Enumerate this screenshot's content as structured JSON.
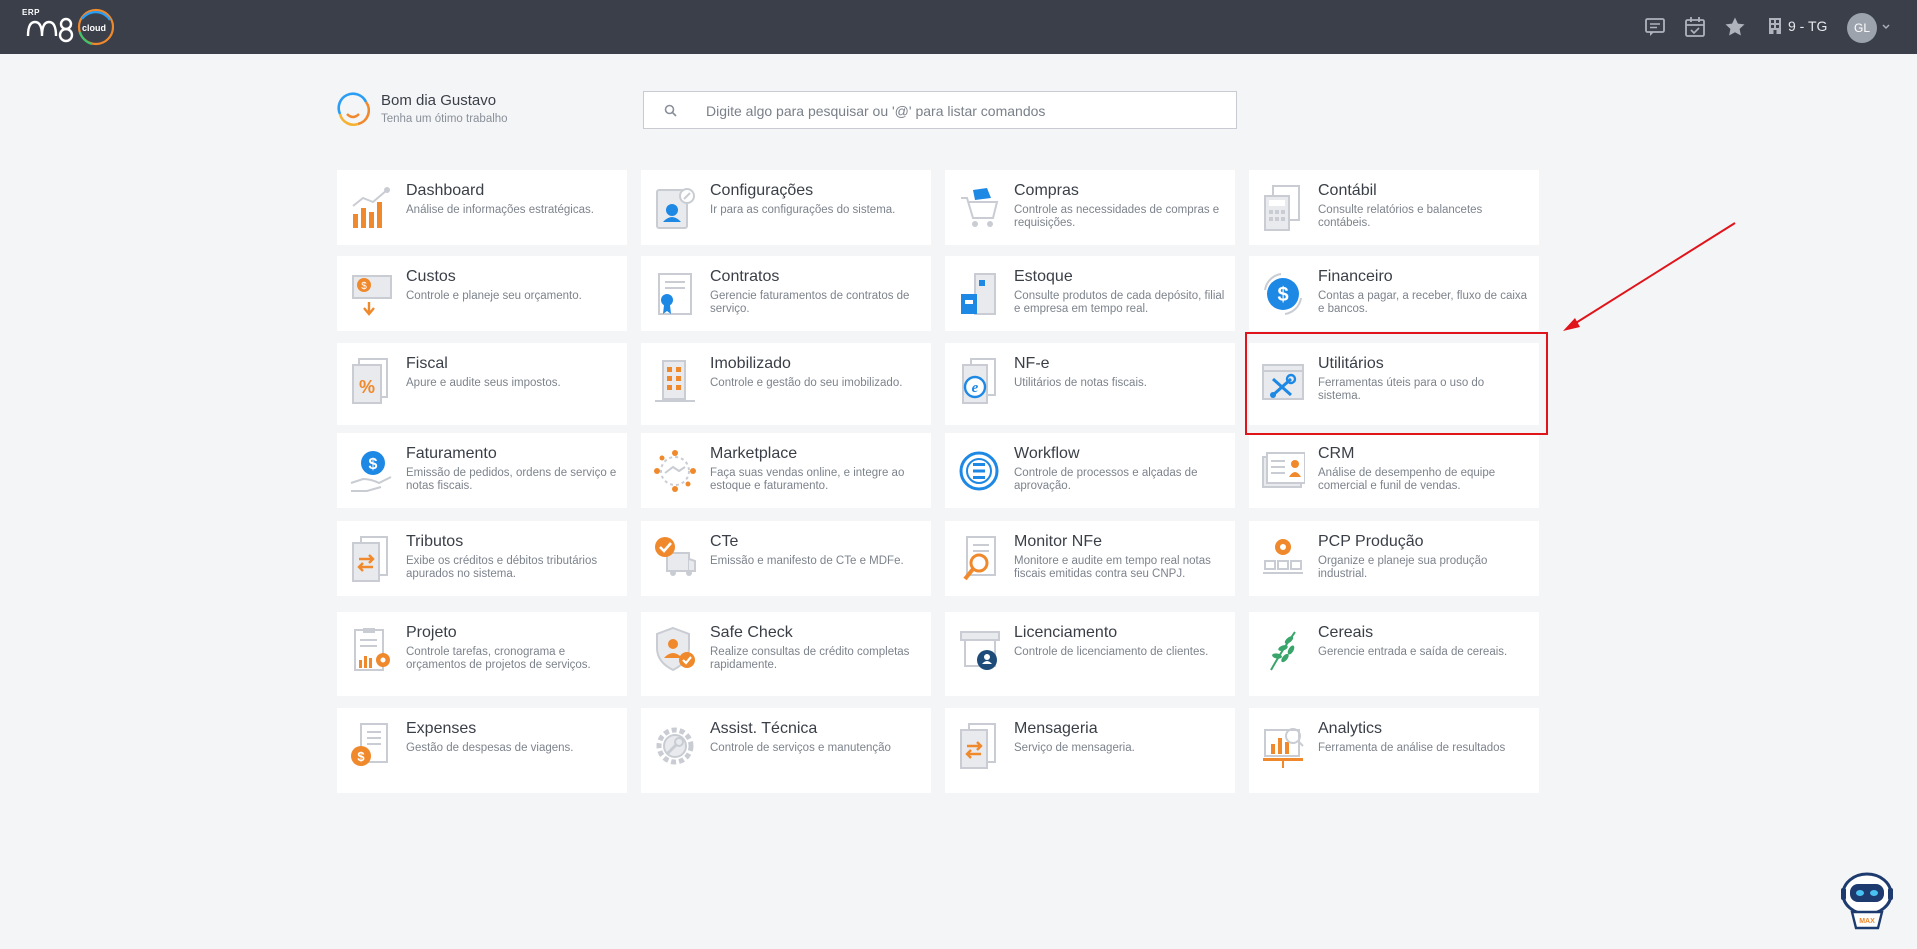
{
  "header": {
    "logo_erp": "ERP",
    "logo_cloud": "cloud",
    "company": "9 - TG",
    "avatar_initials": "GL",
    "icons": [
      "chat-icon",
      "calendar-icon",
      "star-icon",
      "building-icon",
      "chevron-down-icon"
    ]
  },
  "greeting": {
    "title": "Bom dia Gustavo",
    "subtitle": "Tenha um ótimo trabalho"
  },
  "search": {
    "placeholder": "Digite algo para pesquisar ou '@' para listar comandos"
  },
  "modules": [
    {
      "title": "Dashboard",
      "desc": "Análise de informações estratégicas.",
      "icon": "chart-icon"
    },
    {
      "title": "Configurações",
      "desc": "Ir para as configurações do sistema.",
      "icon": "settings-icon"
    },
    {
      "title": "Compras",
      "desc": "Controle as necessidades de compras e requisições.",
      "icon": "cart-icon"
    },
    {
      "title": "Contábil",
      "desc": "Consulte relatórios e balancetes contábeis.",
      "icon": "calculator-icon"
    },
    {
      "title": "Custos",
      "desc": "Controle e planeje seu orçamento.",
      "icon": "costs-icon"
    },
    {
      "title": "Contratos",
      "desc": "Gerencie faturamentos de contratos de serviço.",
      "icon": "contract-icon"
    },
    {
      "title": "Estoque",
      "desc": "Consulte produtos de cada depósito, filial e empresa em tempo real.",
      "icon": "warehouse-icon"
    },
    {
      "title": "Financeiro",
      "desc": "Contas a pagar, a receber, fluxo de caixa e bancos.",
      "icon": "money-icon"
    },
    {
      "title": "Fiscal",
      "desc": "Apure e audite seus impostos.",
      "icon": "percent-icon"
    },
    {
      "title": "Imobilizado",
      "desc": "Controle e gestão do seu imobilizado.",
      "icon": "building-icon"
    },
    {
      "title": "NF-e",
      "desc": "Utilitários de notas fiscais.",
      "icon": "nfe-icon"
    },
    {
      "title": "Utilitários",
      "desc": "Ferramentas úteis para o uso do sistema.",
      "icon": "tools-icon"
    },
    {
      "title": "Faturamento",
      "desc": "Emissão de pedidos, ordens de serviço e notas fiscais.",
      "icon": "billing-icon"
    },
    {
      "title": "Marketplace",
      "desc": "Faça suas vendas online, e integre ao estoque e faturamento.",
      "icon": "marketplace-icon"
    },
    {
      "title": "Workflow",
      "desc": "Controle de processos e alçadas de aprovação.",
      "icon": "workflow-icon"
    },
    {
      "title": "CRM",
      "desc": "Análise de desempenho de equipe comercial e funil de vendas.",
      "icon": "crm-icon"
    },
    {
      "title": "Tributos",
      "desc": "Exibe os créditos e débitos tributários apurados no sistema.",
      "icon": "taxes-icon"
    },
    {
      "title": "CTe",
      "desc": "Emissão e manifesto de CTe e MDFe.",
      "icon": "truck-icon"
    },
    {
      "title": "Monitor NFe",
      "desc": "Monitore e audite em tempo real notas fiscais emitidas contra seu CNPJ.",
      "icon": "magnifier-icon"
    },
    {
      "title": "PCP Produção",
      "desc": "Organize e planeje sua produção industrial.",
      "icon": "production-icon"
    },
    {
      "title": "Projeto",
      "desc": "Controle tarefas, cronograma e orçamentos de projetos de serviços.",
      "icon": "project-icon"
    },
    {
      "title": "Safe Check",
      "desc": "Realize consultas de crédito completas rapidamente.",
      "icon": "shield-icon"
    },
    {
      "title": "Licenciamento",
      "desc": "Controle de licenciamento de clientes.",
      "icon": "license-icon"
    },
    {
      "title": "Cereais",
      "desc": "Gerencie entrada e saída de cereais.",
      "icon": "plant-icon"
    },
    {
      "title": "Expenses",
      "desc": "Gestão de despesas de viagens.",
      "icon": "expenses-icon"
    },
    {
      "title": "Assist. Técnica",
      "desc": "Controle de serviços e manutenção",
      "icon": "gear-icon"
    },
    {
      "title": "Mensageria",
      "desc": "Serviço de mensageria.",
      "icon": "messaging-icon"
    },
    {
      "title": "Analytics",
      "desc": "Ferramenta de análise de resultados",
      "icon": "analytics-icon"
    }
  ],
  "colors": {
    "topbar": "#3b3f4a",
    "background": "#f4f5f7",
    "accent_blue": "#1e88e5",
    "accent_orange": "#f0892b",
    "highlight_red": "#e0141b"
  }
}
